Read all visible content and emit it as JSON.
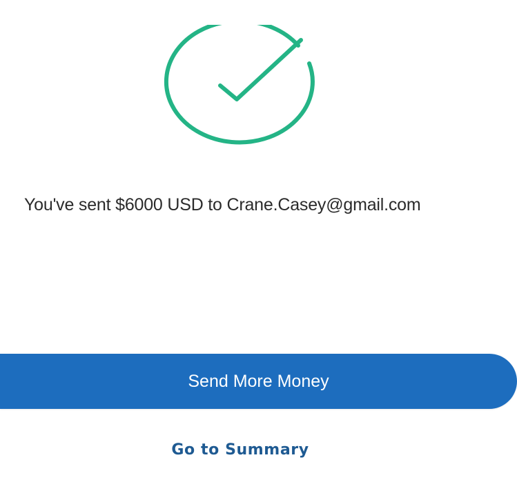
{
  "status": {
    "icon": "check-circle-icon",
    "color": "#24b486"
  },
  "message": "You've sent $6000 USD to Crane.Casey@gmail.com",
  "actions": {
    "primary_label": "Send More Money",
    "secondary_label": "Go to Summary"
  },
  "colors": {
    "primary_button": "#1d6dbe",
    "link": "#1e5a92"
  }
}
